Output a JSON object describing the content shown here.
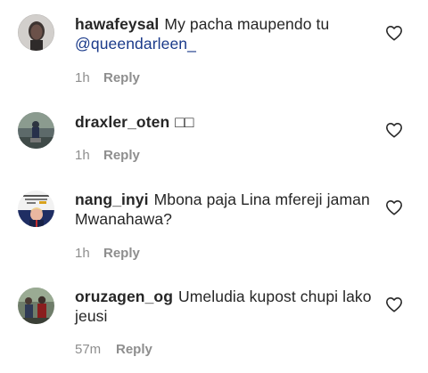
{
  "comments": [
    {
      "username": "hawafeysal",
      "text": "My pacha maupendo tu",
      "mention": "@queendarleen_",
      "time": "1h",
      "reply_label": "Reply",
      "avatar_icon": "avatar-woman-photo"
    },
    {
      "username": "draxler_oten",
      "text": "□□",
      "mention": "",
      "time": "1h",
      "reply_label": "Reply",
      "avatar_icon": "avatar-man-statue-photo"
    },
    {
      "username": "nang_inyi",
      "text": "Mbona paja Lina mfereji jaman Mwanahawa?",
      "mention": "",
      "time": "1h",
      "reply_label": "Reply",
      "avatar_icon": "avatar-meme-photo"
    },
    {
      "username": "oruzagen_og",
      "text": "Umeludia kupost chupi lako jeusi",
      "mention": "",
      "time": "57m",
      "reply_label": "Reply",
      "avatar_icon": "avatar-group-photo"
    }
  ],
  "colors": {
    "text": "#262626",
    "secondary": "#8e8e8e",
    "mention": "#1a3a8a",
    "background": "#ffffff"
  },
  "like_icon": "heart-outline-icon"
}
